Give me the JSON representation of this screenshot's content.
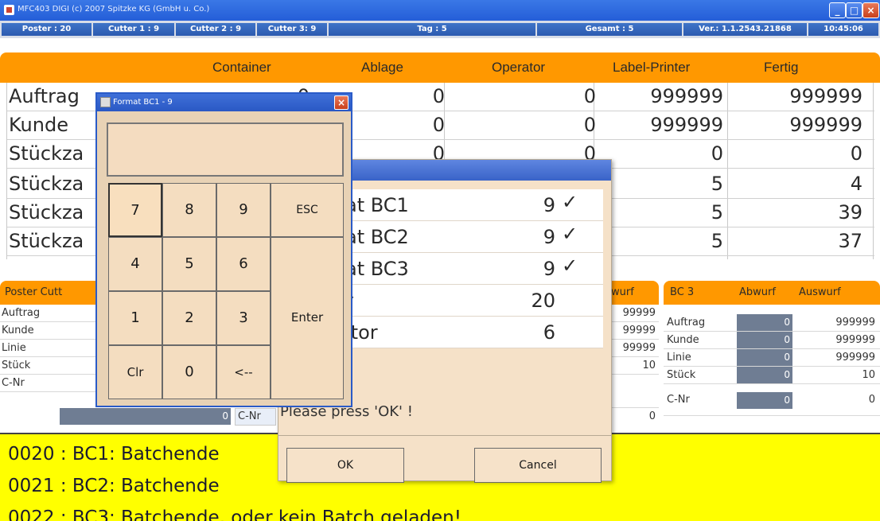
{
  "window": {
    "title": "MFC403 DIGI  (c) 2007  Spitzke KG (GmbH u. Co.)"
  },
  "status_bar": {
    "poster": "Poster : 20",
    "cutter1": "Cutter 1 : 9",
    "cutter2": "Cutter 2 : 9",
    "cutter3": "Cutter 3: 9",
    "tag": "Tag : 5",
    "gesamt": "Gesamt : 5",
    "version": "Ver.: 1.1.2543.21868",
    "time": "10:45:06"
  },
  "main_table": {
    "headers": [
      "Container",
      "Ablage",
      "Operator",
      "Label-Printer",
      "Fertig"
    ],
    "rows": [
      {
        "label": "Auftrag",
        "container": "0",
        "ablage": "0",
        "operator": "0",
        "label_printer": "999999",
        "fertig": "999999"
      },
      {
        "label": "Kunde",
        "ablage": "0",
        "operator": "0",
        "label_printer": "999999",
        "fertig": "999999"
      },
      {
        "label": "Stückza",
        "ablage": "0",
        "operator": "0",
        "label_printer": "0",
        "fertig": "0"
      },
      {
        "label": "Stückza",
        "label_printer": "5",
        "fertig": "4"
      },
      {
        "label": "Stückza",
        "label_printer": "5",
        "fertig": "39"
      },
      {
        "label": "Stückza",
        "label_printer": "5",
        "fertig": "37"
      }
    ]
  },
  "panels": {
    "poster_cutter": {
      "title": "Poster Cutt",
      "rows": [
        "Auftrag",
        "Kunde",
        "Linie",
        "Stück",
        "C-Nr"
      ],
      "cnr_value": "0"
    },
    "bc2": {
      "abwurf_header": "wurf",
      "cnr_label": "C-Nr",
      "values": [
        "99999",
        "99999",
        "99999",
        "10",
        "0"
      ]
    },
    "bc3": {
      "title": "BC 3",
      "abwurf": "Abwurf",
      "auswurf": "Auswurf",
      "rows": [
        {
          "label": "Auftrag",
          "abwurf": "0",
          "auswurf": "999999"
        },
        {
          "label": "Kunde",
          "abwurf": "0",
          "auswurf": "999999"
        },
        {
          "label": "Linie",
          "abwurf": "0",
          "auswurf": "999999"
        },
        {
          "label": "Stück",
          "abwurf": "0",
          "auswurf": "10"
        },
        {
          "label": "C-Nr",
          "abwurf": "0",
          "auswurf": "0"
        }
      ]
    }
  },
  "log": {
    "lines": [
      "0020 : BC1: Batchende",
      "0021 : BC2: Batchende",
      "0022 : BC3: Batchende, oder kein Batch geladen!"
    ]
  },
  "message_dialog": {
    "rows": [
      {
        "label": "at BC1",
        "value": "9",
        "check": "✓"
      },
      {
        "label": "at BC2",
        "value": "9",
        "check": "✓"
      },
      {
        "label": "at BC3",
        "value": "9",
        "check": "✓"
      },
      {
        "label": "r",
        "value": "20",
        "check": ""
      },
      {
        "label": "itor",
        "value": "6",
        "check": ""
      }
    ],
    "message": "Please press 'OK' !",
    "ok_label": "OK",
    "cancel_label": "Cancel"
  },
  "keypad_dialog": {
    "title": "Format BC1  -  9",
    "display_value": "",
    "keys": {
      "k7": "7",
      "k8": "8",
      "k9": "9",
      "esc": "ESC",
      "k4": "4",
      "k5": "5",
      "k6": "6",
      "enter": "Enter",
      "k1": "1",
      "k2": "2",
      "k3": "3",
      "clr": "Clr",
      "k0": "0",
      "back": "<--"
    }
  },
  "colors": {
    "accent_orange": "#ff9800",
    "log_yellow": "#ffff00",
    "titlebar_blue": "#2a58c4",
    "dialog_beige": "#f5e1c8",
    "cell_gray": "#6f7d93"
  }
}
